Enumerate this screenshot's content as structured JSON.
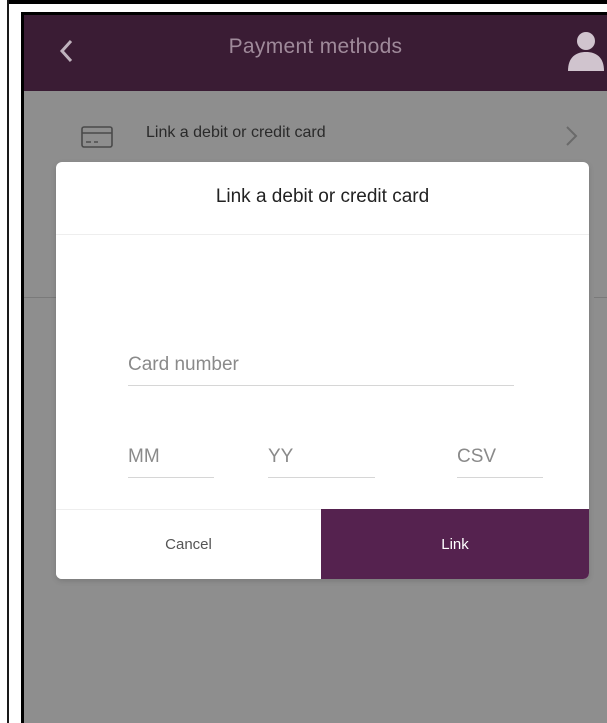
{
  "app": {
    "title": "Payment methods"
  },
  "icons": {
    "back": "chevron-left-icon",
    "account": "person-icon",
    "card": "credit-card-icon",
    "row_chevron": "chevron-right-icon"
  },
  "colors": {
    "appbar": "#3a1c34",
    "accent": "#55224f",
    "overlay": "#8e8e8e"
  },
  "background_list": {
    "items": [
      {
        "label": "Link a debit or credit card"
      }
    ]
  },
  "dialog": {
    "title": "Link a debit or credit card",
    "fields": {
      "card_number": {
        "placeholder": "Card number",
        "value": ""
      },
      "month": {
        "placeholder": "MM",
        "value": ""
      },
      "year": {
        "placeholder": "YY",
        "value": ""
      },
      "csv": {
        "placeholder": "CSV",
        "value": ""
      }
    },
    "cancel_label": "Cancel",
    "link_label": "Link"
  }
}
